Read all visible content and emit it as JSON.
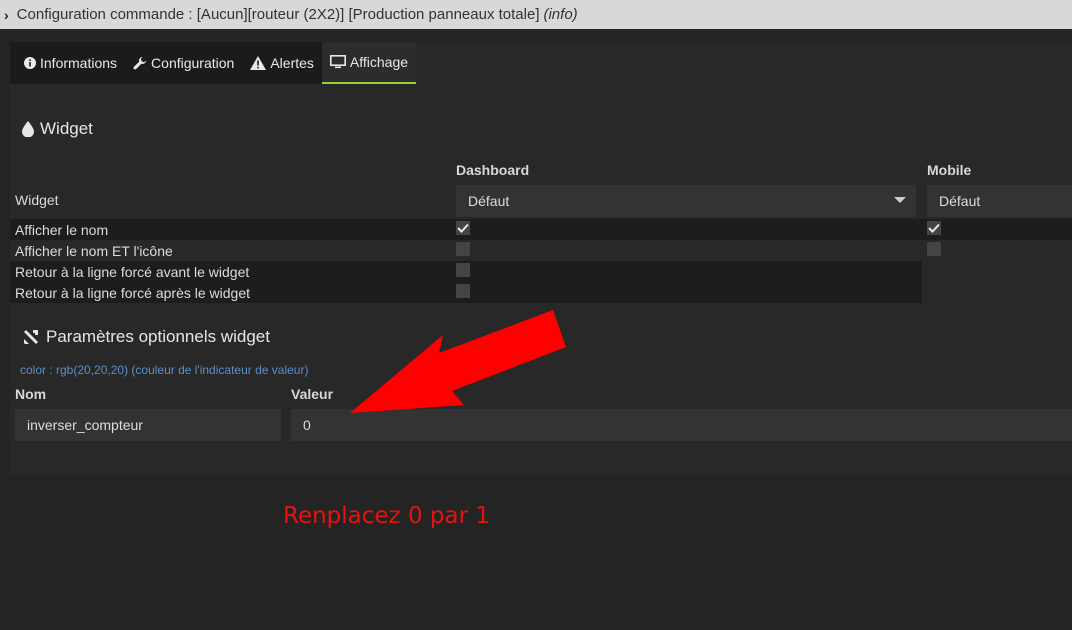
{
  "titlebar": {
    "text": "Configuration commande : [Aucun][routeur (2X2)] [Production panneaux totale]",
    "info": "(info)"
  },
  "tabs": [
    {
      "label": "Informations",
      "icon": "info-circle-icon"
    },
    {
      "label": "Configuration",
      "icon": "wrench-icon"
    },
    {
      "label": "Alertes",
      "icon": "warning-icon"
    },
    {
      "label": "Affichage",
      "icon": "monitor-icon",
      "active": true
    }
  ],
  "widget_section": {
    "title": "Widget",
    "icon": "droplet-icon",
    "col_dashboard": "Dashboard",
    "col_mobile": "Mobile",
    "widget_label": "Widget",
    "dashboard_value": "Défaut",
    "mobile_value": "Défaut",
    "options": [
      {
        "label": "Afficher le nom",
        "dashboard": true,
        "mobile": true
      },
      {
        "label": "Afficher le nom ET l'icône",
        "dashboard": false,
        "mobile": false
      },
      {
        "label": "Retour à la ligne forcé avant le widget",
        "dashboard": false
      },
      {
        "label": "Retour à la ligne forcé après le widget",
        "dashboard": false
      }
    ]
  },
  "params_section": {
    "title": "Paramètres optionnels widget",
    "icon": "tools-icon",
    "hint": "color : rgb(20,20,20) (couleur de l'indicateur de valeur)",
    "col_name": "Nom",
    "col_value": "Valeur",
    "param_name": "inverser_compteur",
    "param_value": "0"
  },
  "annotation": {
    "text": "Renplacez 0 par 1",
    "color": "#e8110e"
  }
}
